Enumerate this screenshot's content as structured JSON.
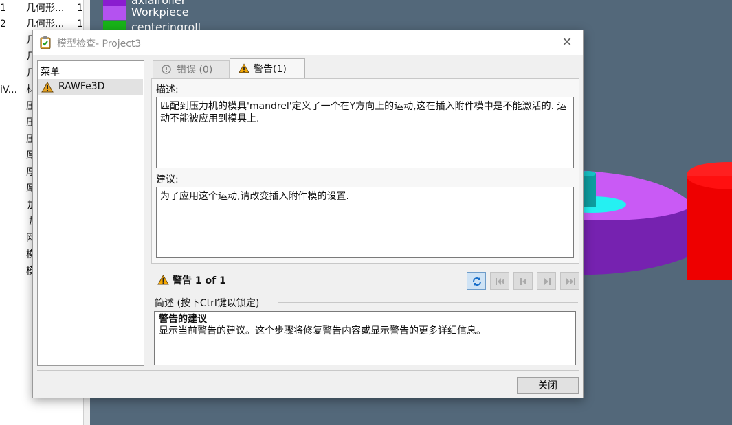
{
  "background": {
    "tree_rows": [
      {
        "num": "1",
        "text": "几何形...",
        "count": "1"
      },
      {
        "num": "2",
        "text": "几何形...",
        "count": "1"
      },
      {
        "num": "",
        "text": "几",
        "count": ""
      },
      {
        "num": "",
        "text": "几",
        "count": ""
      },
      {
        "num": "",
        "text": "几",
        "count": ""
      },
      {
        "num": "iV...",
        "text": "材",
        "count": ""
      },
      {
        "num": "",
        "text": "压",
        "count": ""
      },
      {
        "num": "",
        "text": "压",
        "count": ""
      },
      {
        "num": "",
        "text": "压",
        "count": ""
      },
      {
        "num": "",
        "text": "厚",
        "count": ""
      },
      {
        "num": "",
        "text": "厚",
        "count": ""
      },
      {
        "num": "",
        "text": "厚",
        "count": ""
      },
      {
        "num": "",
        "text": "加",
        "count": ""
      },
      {
        "num": "",
        "text": "加",
        "count": ""
      },
      {
        "num": "",
        "text": "网",
        "count": ""
      },
      {
        "num": "",
        "text": "模",
        "count": ""
      },
      {
        "num": "",
        "text": "模",
        "count": ""
      }
    ],
    "legend": [
      {
        "label": "axialroller",
        "color": "#8a1ccf"
      },
      {
        "label": "Workpiece",
        "color": "#b452f0"
      },
      {
        "label": "centeringroll",
        "color": "#18b418"
      }
    ]
  },
  "dialog": {
    "title": "模型检查- Project3",
    "menu_header": "菜单",
    "menu_items": [
      {
        "label": "RAWFe3D"
      }
    ],
    "tabs": {
      "errors": "错误 (0)",
      "warnings": "警告(1)"
    },
    "description_label": "描述:",
    "description_text": "匹配到压力机的模具'mandrel'定义了一个在Y方向上的运动,这在插入附件模中是不能激活的. 运动不能被应用到模具上.",
    "suggestion_label": "建议:",
    "suggestion_text": "为了应用这个运动,请改变插入附件模的设置.",
    "status_text": "警告 1 of 1",
    "summary_header": "简述 (按下Ctrl键以锁定)",
    "summary_title": "警告的建议",
    "summary_text": "显示当前警告的建议。这个步骤将修复警告内容或显示警告的更多详细信息。",
    "close_label": "关闭"
  }
}
